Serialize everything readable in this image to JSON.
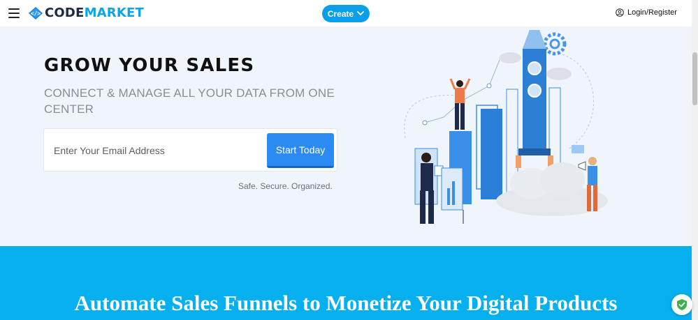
{
  "header": {
    "logo": {
      "part1": "CODE",
      "part2": "MARKET",
      "mark_icon": "code-tag-icon"
    },
    "menu_icon": "hamburger-icon",
    "create_label": "Create",
    "create_icon": "chevron-down-icon",
    "login_label": "Login/Register",
    "login_icon": "user-circle-icon"
  },
  "hero": {
    "title": "GROW YOUR SALES",
    "subtitle": "CONNECT & MANAGE ALL YOUR DATA FROM ONE CENTER",
    "email_placeholder": "Enter Your Email Address",
    "email_value": "",
    "cta_label": "Start Today",
    "note": "Safe. Secure. Organized."
  },
  "banner": {
    "title": "Automate Sales Funnels to Monetize Your Digital Products"
  },
  "badge": {
    "icon": "shield-check-icon"
  },
  "colors": {
    "accent": "#0a9fe8",
    "cta": "#2c8bf2",
    "hero_bg": "#f0f5fc",
    "banner_bg": "#06b0ef"
  }
}
